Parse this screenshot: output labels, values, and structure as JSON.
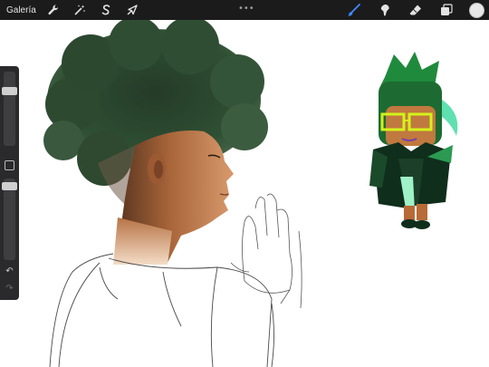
{
  "toolbar": {
    "gallery_label": "Galería",
    "left_tools": [
      {
        "icon": "wrench-icon",
        "name": "actions-button"
      },
      {
        "icon": "magic-wand-icon",
        "name": "adjustments-button"
      },
      {
        "icon": "selection-s-icon",
        "name": "selection-button"
      },
      {
        "icon": "arrow-cursor-icon",
        "name": "transform-button"
      }
    ],
    "more_dots": "•••",
    "right_tools": [
      {
        "icon": "brush-icon",
        "name": "brush-tool",
        "active_color": "#3d8bff"
      },
      {
        "icon": "smudge-icon",
        "name": "smudge-tool"
      },
      {
        "icon": "eraser-icon",
        "name": "eraser-tool"
      },
      {
        "icon": "layers-icon",
        "name": "layers-button"
      }
    ],
    "current_color": "#e8e8e8"
  },
  "sidebar": {
    "size_slider_level": 0.9,
    "opacity_slider_level": 0.98,
    "undo_glyph": "↶",
    "redo_glyph": "↷"
  },
  "canvas": {
    "artwork_primary": "sketch-of-person-with-afro-hair",
    "artwork_secondary": "green-cookie-character-sticker"
  },
  "colors": {
    "toolbar_bg": "#1b1b1c",
    "sidebar_bg": "#2a2a2c",
    "accent_blue": "#3d8bff",
    "hair_green": "#2e4a32",
    "skin": "#b06a3c"
  }
}
